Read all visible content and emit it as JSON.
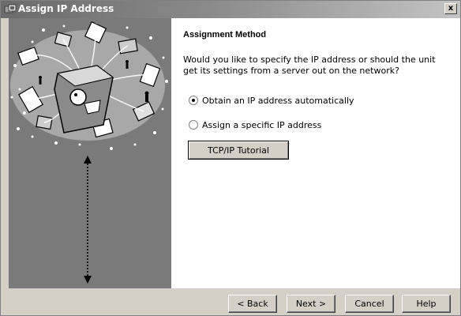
{
  "window": {
    "title": "Assign IP Address",
    "close_label": "x"
  },
  "content": {
    "section_title": "Assignment Method",
    "description": "Would you like to specify the IP address or should the unit get its settings from a server out on the network?",
    "options": [
      {
        "label": "Obtain an IP address automatically",
        "selected": true
      },
      {
        "label": "Assign a specific IP address",
        "selected": false
      }
    ],
    "tutorial_button": "TCP/IP Tutorial"
  },
  "buttons": {
    "back": "< Back",
    "next": "Next >",
    "cancel": "Cancel",
    "help": "Help"
  },
  "icons": [
    "app-icon",
    "close-icon",
    "network-illustration",
    "double-arrow-icon",
    "radio-selected-icon",
    "radio-unselected-icon"
  ]
}
